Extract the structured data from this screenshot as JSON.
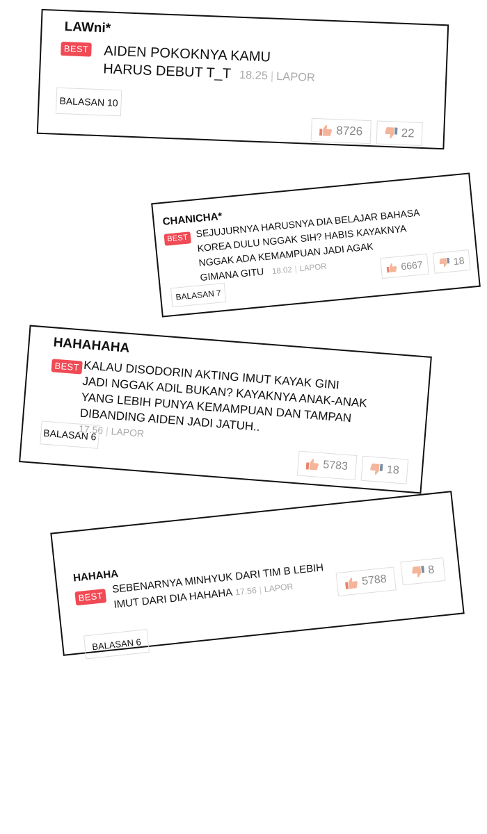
{
  "comments": [
    {
      "username": "LAWni*",
      "badge": "BEST",
      "text_lines": [
        "AIDEN POKOKNYA KAMU",
        "HARUS DEBUT T_T"
      ],
      "time": "18.25",
      "report": "LAPOR",
      "replies": "BALASAN 10",
      "likes": "8726",
      "dislikes": "22"
    },
    {
      "username": "CHANICHA*",
      "badge": "BEST",
      "text_lines": [
        "SEJUJURNYA HARUSNYA DIA BELAJAR BAHASA",
        "KOREA DULU NGGAK SIH? HABIS KAYAKNYA",
        "NGGAK ADA KEMAMPUAN JADI AGAK",
        "GIMANA GITU"
      ],
      "time": "18.02",
      "report": "LAPOR",
      "replies": "BALASAN 7",
      "likes": "6667",
      "dislikes": "18"
    },
    {
      "username": "HAHAHAHA",
      "badge": "BEST",
      "text_lines": [
        "KALAU DISODORIN AKTING IMUT KAYAK GINI",
        "JADI NGGAK ADIL BUKAN? KAYAKNYA ANAK-ANAK",
        "YANG LEBIH PUNYA KEMAMPUAN DAN TAMPAN",
        "DIBANDING AIDEN JADI JATUH.."
      ],
      "time": "17.56",
      "report": "LAPOR",
      "replies": "BALASAN 6",
      "likes": "5783",
      "dislikes": "18"
    },
    {
      "username": "HAHAHA",
      "badge": "BEST",
      "text_lines": [
        "SEBENARNYA MINHYUK DARI TIM B LEBIH",
        "IMUT DARI DIA HAHAHA"
      ],
      "time": "17.56",
      "report": "LAPOR",
      "replies": "BALASAN 6",
      "likes": "5788",
      "dislikes": "8"
    }
  ],
  "colors": {
    "best_badge": "#f04a55",
    "meta_text": "#aaaaaa",
    "border": "#111111"
  },
  "icons": {
    "like": "thumbs-up-icon",
    "dislike": "thumbs-down-icon"
  }
}
